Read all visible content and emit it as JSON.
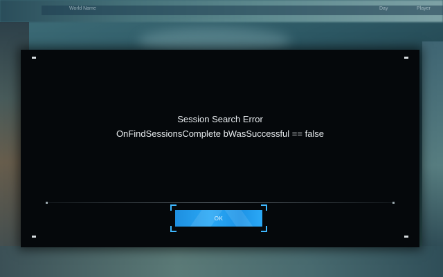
{
  "background": {
    "header_columns": [
      "World Name",
      "Day",
      "Player"
    ]
  },
  "dialog": {
    "title": "Session Search Error",
    "message": "OnFindSessionsComplete bWasSuccessful == false",
    "ok_label": "OK"
  },
  "colors": {
    "dialog_bg": "#05080b",
    "accent": "#2aa8f5",
    "bracket": "#3fb8ff",
    "text": "#e8ecef"
  }
}
